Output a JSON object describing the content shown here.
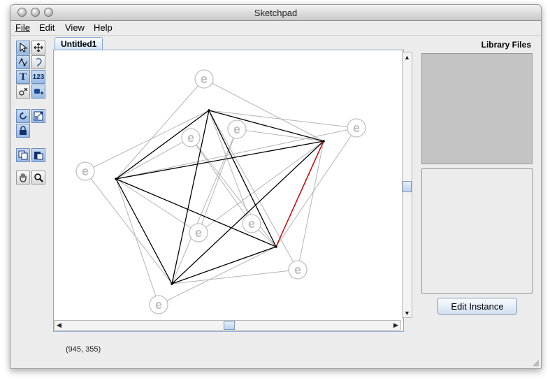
{
  "window": {
    "title": "Sketchpad"
  },
  "menubar": {
    "items": [
      "File",
      "Edit",
      "View",
      "Help"
    ]
  },
  "tools": [
    {
      "name": "select-tool",
      "icon": "arrow-pointer-icon",
      "selected": true
    },
    {
      "name": "move-tool",
      "icon": "move-arrows-icon",
      "selected": false
    },
    {
      "name": "polyline-tool",
      "icon": "polyline-icon",
      "selected": false
    },
    {
      "name": "lasso-tool",
      "icon": "lasso-icon",
      "selected": false
    },
    {
      "name": "text-tool",
      "icon": "text-t-icon",
      "label": "T",
      "selected": false
    },
    {
      "name": "number-tool",
      "icon": "number-icon",
      "label": "123",
      "selected": false
    },
    {
      "name": "delete-point-tool",
      "icon": "point-delete-icon",
      "selected": false
    },
    {
      "name": "add-instance-tool",
      "icon": "instance-add-icon",
      "selected": false
    },
    {
      "name": "rotate-tool",
      "icon": "rotate-icon",
      "selected": false
    },
    {
      "name": "scale-tool",
      "icon": "scale-icon",
      "selected": false
    },
    {
      "name": "lock-tool",
      "icon": "lock-icon",
      "selected": false
    },
    {
      "name": "copy-tool",
      "icon": "copy-icon",
      "selected": false
    },
    {
      "name": "paste-tool",
      "icon": "paste-icon",
      "selected": false
    },
    {
      "name": "hand-tool",
      "icon": "hand-icon",
      "selected": false
    },
    {
      "name": "zoom-tool",
      "icon": "magnifier-icon",
      "selected": false
    }
  ],
  "document": {
    "tab_label": "Untitled1"
  },
  "status": {
    "coordinates": "(945, 355)"
  },
  "library": {
    "title": "Library Files"
  },
  "edit_instance_label": "Edit Instance",
  "drawing": {
    "instance_glyph": "e",
    "colors": {
      "bold_line": "#000000",
      "highlight_line": "#cc0000",
      "faint_line": "#b4b4b4",
      "instance": "#c0c0c0"
    }
  }
}
